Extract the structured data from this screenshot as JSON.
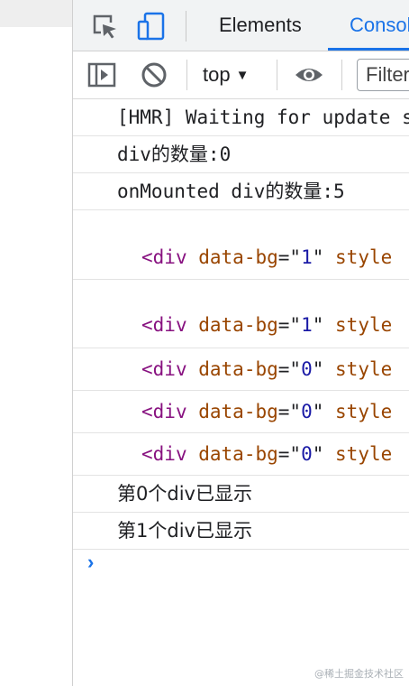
{
  "devtools": {
    "tabs": [
      {
        "label": "Elements",
        "active": false
      },
      {
        "label": "Console",
        "active": true
      }
    ],
    "toolbar": {
      "context": "top",
      "filter_placeholder": "Filter"
    }
  },
  "console": {
    "messages": [
      "[HMR] Waiting for update signal from WDS...",
      "div的数量:0",
      "onMounted div的数量:5"
    ],
    "nodes": [
      {
        "tag": "div",
        "attr": "data-bg",
        "value": "1",
        "rest": "style"
      },
      {
        "tag": "div",
        "attr": "data-bg",
        "value": "1",
        "rest": "style"
      },
      {
        "tag": "div",
        "attr": "data-bg",
        "value": "0",
        "rest": "style"
      },
      {
        "tag": "div",
        "attr": "data-bg",
        "value": "0",
        "rest": "style"
      },
      {
        "tag": "div",
        "attr": "data-bg",
        "value": "0",
        "rest": "style"
      }
    ],
    "logs": [
      "第0个div已显示",
      "第1个div已显示"
    ],
    "prompt": "›"
  },
  "watermark": "@稀土掘金技术社区",
  "colors": {
    "accent": "#1a73e8",
    "tag": "#881280",
    "attr": "#994500",
    "value": "#1a1aa6"
  }
}
